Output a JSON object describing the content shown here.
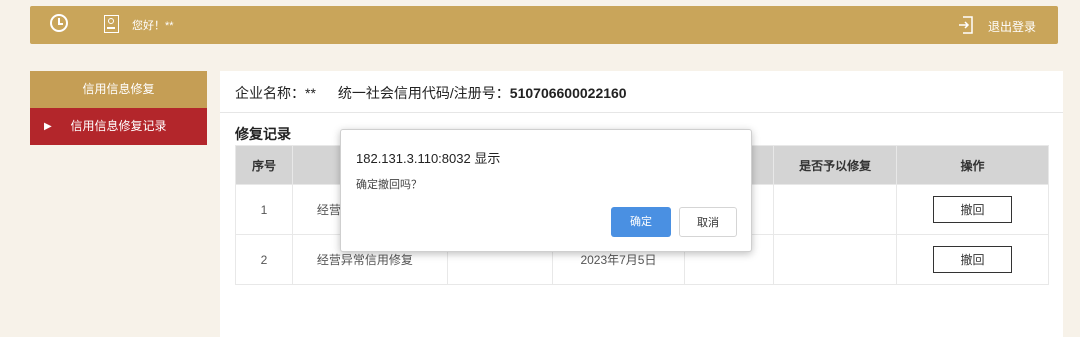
{
  "header": {
    "greeting": "您好！**",
    "logout_label": "退出登录"
  },
  "sidebar": {
    "items": [
      {
        "label": "信用信息修复"
      },
      {
        "label": "信用信息修复记录"
      }
    ]
  },
  "main": {
    "company_label": "企业名称：**",
    "code_label": "统一社会信用代码/注册号：",
    "code_value": "510706600022160",
    "section_title": "修复记录",
    "table": {
      "headers": [
        "序号",
        "",
        "",
        "",
        "是",
        "是否予以修复",
        "操作"
      ],
      "rows": [
        {
          "index": "1",
          "type": "经营",
          "date": "",
          "action": "撤回"
        },
        {
          "index": "2",
          "type": "经营异常信用修复",
          "date": "2023年7月5日",
          "action": "撤回"
        }
      ]
    }
  },
  "dialog": {
    "title": "182.131.3.110:8032 显示",
    "message": "确定撤回吗？",
    "ok_label": "确定",
    "cancel_label": "取消"
  },
  "colors": {
    "topbar": "#c9a55a",
    "sidebar_active": "#b3262b",
    "sidebar_item": "#c59e55",
    "ok_button": "#4a90e2"
  }
}
